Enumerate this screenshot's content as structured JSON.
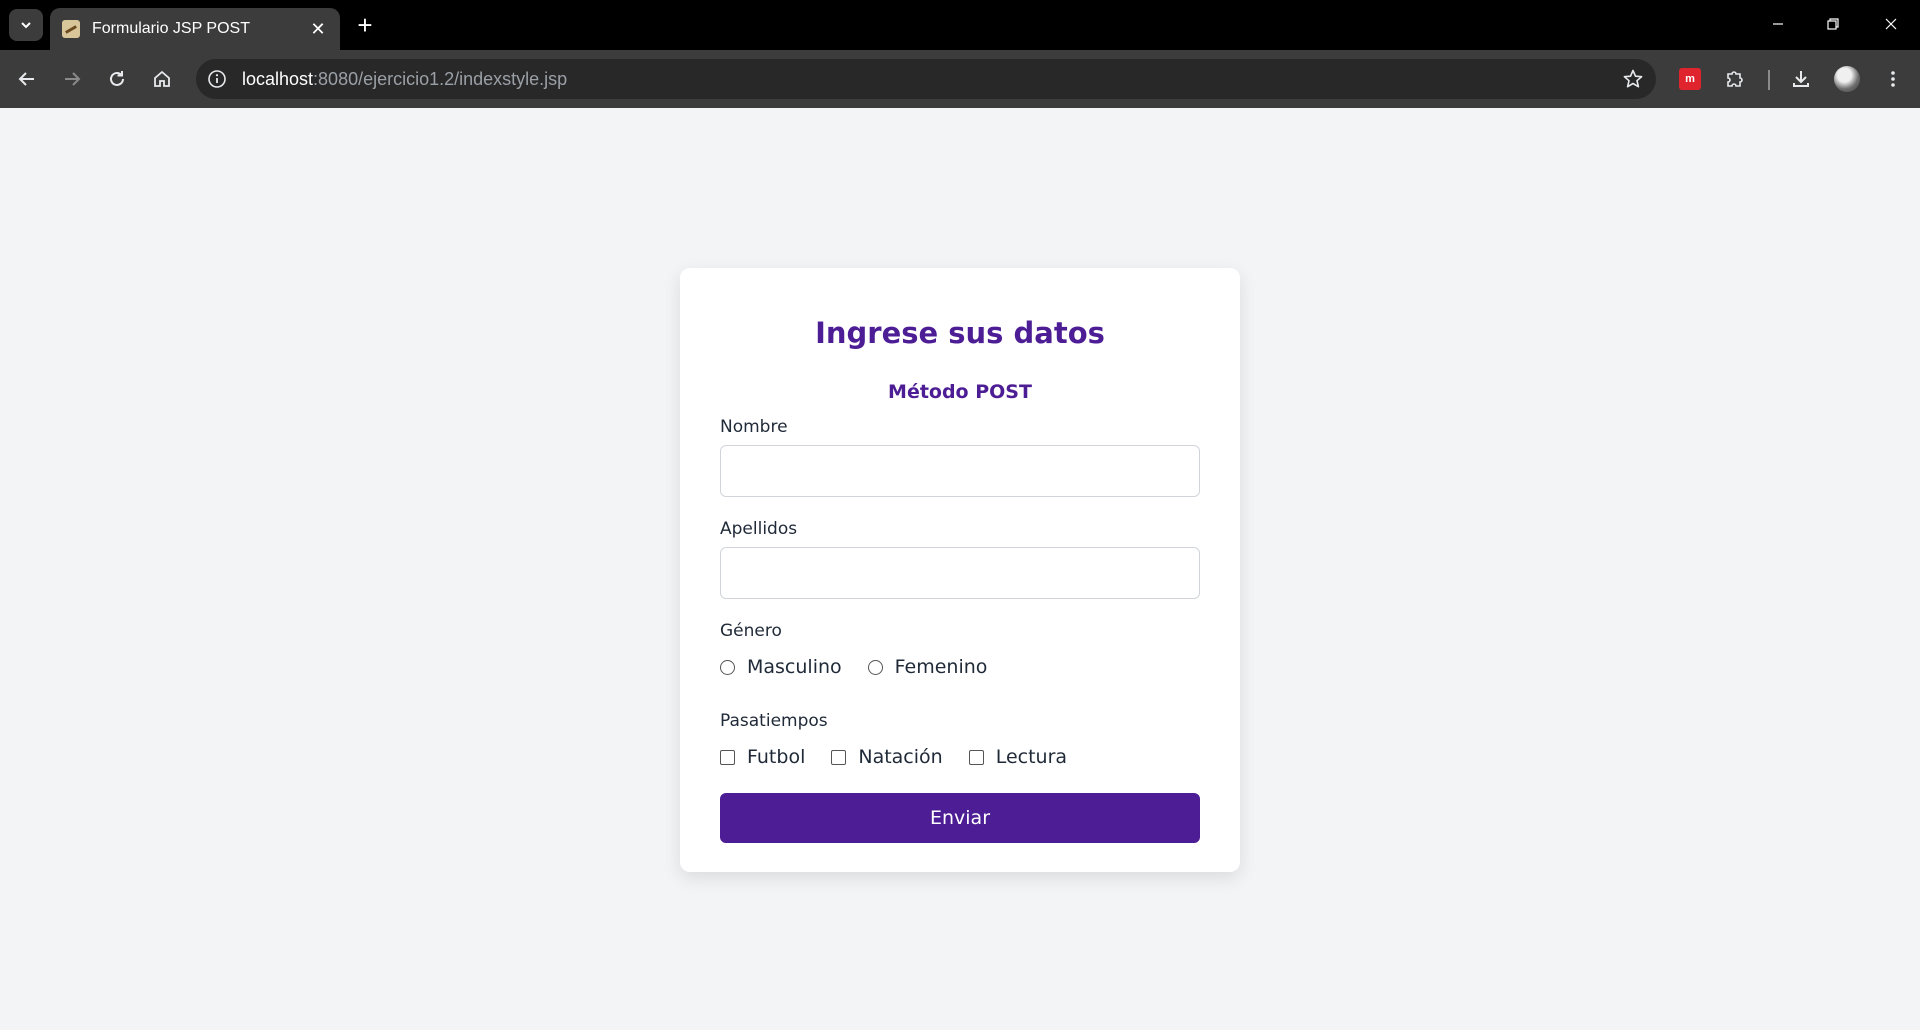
{
  "browser": {
    "tab_title": "Formulario JSP POST",
    "url_host": "localhost",
    "url_rest": ":8080/ejercicio1.2/indexstyle.jsp"
  },
  "form": {
    "title": "Ingrese sus datos",
    "subtitle": "Método POST",
    "nombre_label": "Nombre",
    "nombre_value": "",
    "apellidos_label": "Apellidos",
    "apellidos_value": "",
    "genero_label": "Género",
    "genero_options": [
      "Masculino",
      "Femenino"
    ],
    "pasatiempos_label": "Pasatiempos",
    "pasatiempos_options": [
      "Futbol",
      "Natación",
      "Lectura"
    ],
    "submit_label": "Enviar"
  },
  "colors": {
    "accent": "#4c1d95",
    "page_background": "#f3f4f6",
    "card_background": "#ffffff",
    "browser_tabbar": "#000000",
    "browser_toolbar": "#3c3c3c"
  },
  "icons": [
    "tab-search-icon",
    "favicon-icon",
    "close-icon",
    "plus-icon",
    "minimize-icon",
    "restore-icon",
    "back-arrow-icon",
    "forward-arrow-icon",
    "reload-icon",
    "home-icon",
    "info-icon",
    "star-icon",
    "extension-red-icon",
    "puzzle-icon",
    "download-icon",
    "menu-dots-icon"
  ]
}
